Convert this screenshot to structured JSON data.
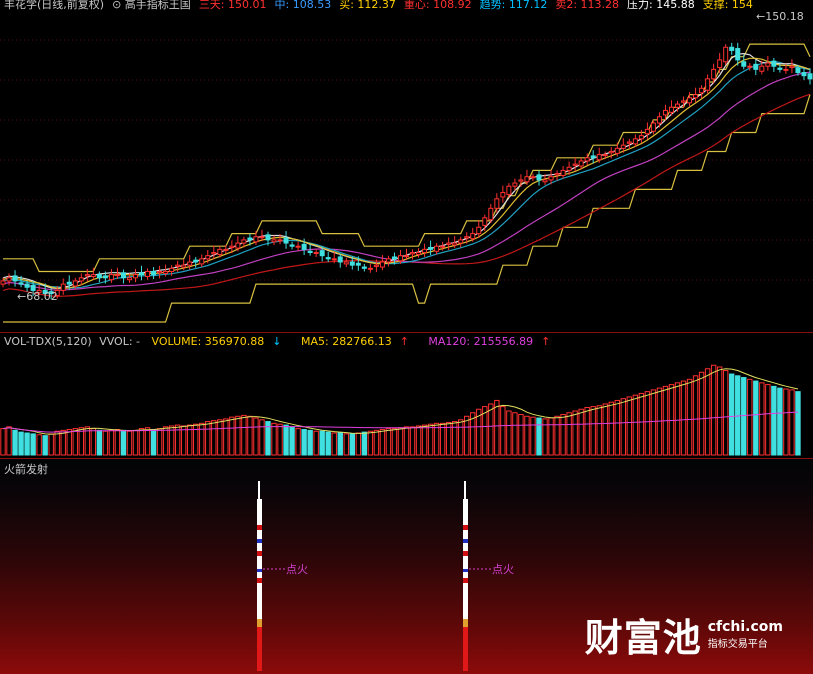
{
  "price_header": {
    "items": [
      {
        "text": "丰花学(日线,前复权)",
        "color": "#c8c8c8"
      },
      {
        "text": "⊙ 高手指标王国",
        "color": "#c8c8c8"
      },
      {
        "text": "三天: 150.01",
        "color": "#ff3030"
      },
      {
        "text": "中: 108.53",
        "color": "#3a9cff"
      },
      {
        "text": "买: 112.37",
        "color": "#ffd000"
      },
      {
        "text": "重心: 108.92",
        "color": "#ff3030"
      },
      {
        "text": "趋势: 117.12",
        "color": "#00c0ff"
      },
      {
        "text": "卖2: 113.28",
        "color": "#ff3030"
      },
      {
        "text": "压力: 145.88",
        "color": "#ffffff"
      },
      {
        "text": "支撑: 154",
        "color": "#ffd000"
      }
    ],
    "high_label": "150.18",
    "low_label": "68.02"
  },
  "volume_header": {
    "name": "VOL-TDX(5,120)",
    "vvol": "VVOL: -",
    "volume": "VOLUME: 356970.88",
    "ma5": "MA5: 282766.13",
    "ma120": "MA120: 215556.89",
    "colors": {
      "name": "#c8c8c8",
      "volume": "#ffd000",
      "ma5": "#ffd000",
      "ma120": "#e040e0",
      "arrow_down": "#00c8ff",
      "arrow_up": "#ff3030"
    }
  },
  "indicator": {
    "title": "火箭发射",
    "signal_label_1": "点火",
    "signal_label_2": "点火",
    "colors": {
      "title": "#c8c8c8",
      "signal": "#d040d0"
    }
  },
  "watermark": {
    "main": "财富池",
    "site": "cfchi.com",
    "slogan": "指标交易平台"
  },
  "chart_data": {
    "type": "candlestick",
    "x": [
      0,
      1,
      2,
      3,
      4,
      5,
      6,
      7,
      8,
      9,
      10,
      11,
      12,
      13,
      14,
      15,
      16,
      17,
      18,
      19,
      20,
      21,
      22,
      23,
      24,
      25,
      26,
      27,
      28,
      29,
      30,
      31,
      32,
      33,
      34,
      35,
      36,
      37,
      38,
      39,
      40,
      41,
      42,
      43,
      44,
      45,
      46,
      47,
      48,
      49,
      50,
      51,
      52,
      53,
      54,
      55,
      56,
      57,
      58,
      59,
      60,
      61,
      62,
      63,
      64,
      65,
      66,
      67,
      68,
      69,
      70,
      71,
      72,
      73,
      74,
      75,
      76,
      77,
      78,
      79,
      80,
      81,
      82,
      83,
      84,
      85,
      86,
      87,
      88,
      89,
      90,
      91,
      92,
      93,
      94,
      95,
      96,
      97,
      98,
      99,
      100,
      101,
      102,
      103,
      104,
      105,
      106,
      107,
      108,
      109,
      110,
      111,
      112,
      113,
      114,
      115,
      116,
      117,
      118,
      119,
      120,
      121,
      122,
      123,
      124,
      125,
      126,
      127,
      128,
      129,
      130,
      131,
      132,
      133,
      134
    ],
    "close": [
      73,
      74,
      73,
      72,
      71,
      70,
      70,
      69,
      69,
      70,
      72,
      72,
      73,
      74,
      75,
      75,
      74,
      74,
      75,
      75,
      74,
      74,
      75,
      75,
      76,
      75,
      76,
      76,
      77,
      78,
      78,
      79,
      79,
      80,
      81,
      82,
      83,
      83,
      84,
      85,
      86,
      86,
      87,
      87,
      86,
      86,
      86,
      85,
      84,
      84,
      83,
      82,
      82,
      81,
      80,
      80,
      79,
      79,
      78,
      78,
      77,
      77,
      78,
      79,
      80,
      80,
      81,
      81,
      82,
      82,
      83,
      83,
      84,
      84,
      85,
      85,
      86,
      87,
      88,
      90,
      93,
      96,
      99,
      101,
      103,
      104,
      105,
      106,
      106,
      105,
      105,
      106,
      107,
      108,
      109,
      110,
      111,
      112,
      112,
      113,
      113,
      114,
      115,
      116,
      117,
      118,
      119,
      121,
      123,
      125,
      127,
      128,
      129,
      130,
      131,
      132,
      134,
      137,
      140,
      143,
      147,
      146,
      143,
      141,
      141,
      140,
      141,
      142,
      141,
      140,
      140,
      141,
      139,
      138,
      137
    ],
    "volume": [
      30,
      32,
      28,
      26,
      25,
      24,
      23,
      22,
      24,
      27,
      28,
      29,
      30,
      31,
      32,
      30,
      28,
      27,
      28,
      29,
      28,
      27,
      28,
      30,
      31,
      29,
      30,
      32,
      33,
      34,
      33,
      34,
      35,
      36,
      38,
      39,
      40,
      41,
      43,
      44,
      45,
      44,
      42,
      40,
      38,
      36,
      35,
      34,
      32,
      30,
      29,
      28,
      27,
      27,
      26,
      25,
      25,
      24,
      24,
      25,
      26,
      27,
      28,
      29,
      30,
      30,
      31,
      32,
      32,
      33,
      34,
      35,
      36,
      36,
      37,
      38,
      40,
      44,
      48,
      52,
      55,
      58,
      62,
      55,
      50,
      48,
      46,
      44,
      43,
      42,
      41,
      42,
      44,
      46,
      48,
      50,
      52,
      54,
      55,
      56,
      58,
      60,
      62,
      64,
      66,
      68,
      70,
      72,
      74,
      76,
      78,
      80,
      82,
      84,
      86,
      90,
      94,
      98,
      102,
      100,
      96,
      92,
      90,
      88,
      86,
      84,
      82,
      80,
      78,
      76,
      75,
      74,
      72
    ],
    "high_price": 150.18,
    "low_price": 68.02
  }
}
